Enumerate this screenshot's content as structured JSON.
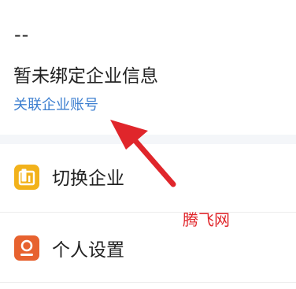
{
  "enterprise": {
    "name_placeholder": "--",
    "status_text": "暂未绑定企业信息",
    "associate_link": "关联企业账号"
  },
  "menu": {
    "items": [
      {
        "label": "切换企业",
        "icon": "switch-enterprise-icon",
        "icon_color": "#f2b21b"
      },
      {
        "label": "个人设置",
        "icon": "personal-settings-icon",
        "icon_color": "#e7622f"
      }
    ]
  },
  "annotation": {
    "watermark": "腾飞网",
    "arrow_color": "#e0262b"
  },
  "colors": {
    "link": "#3d7fd0",
    "section_gap": "#f4f6f9"
  }
}
